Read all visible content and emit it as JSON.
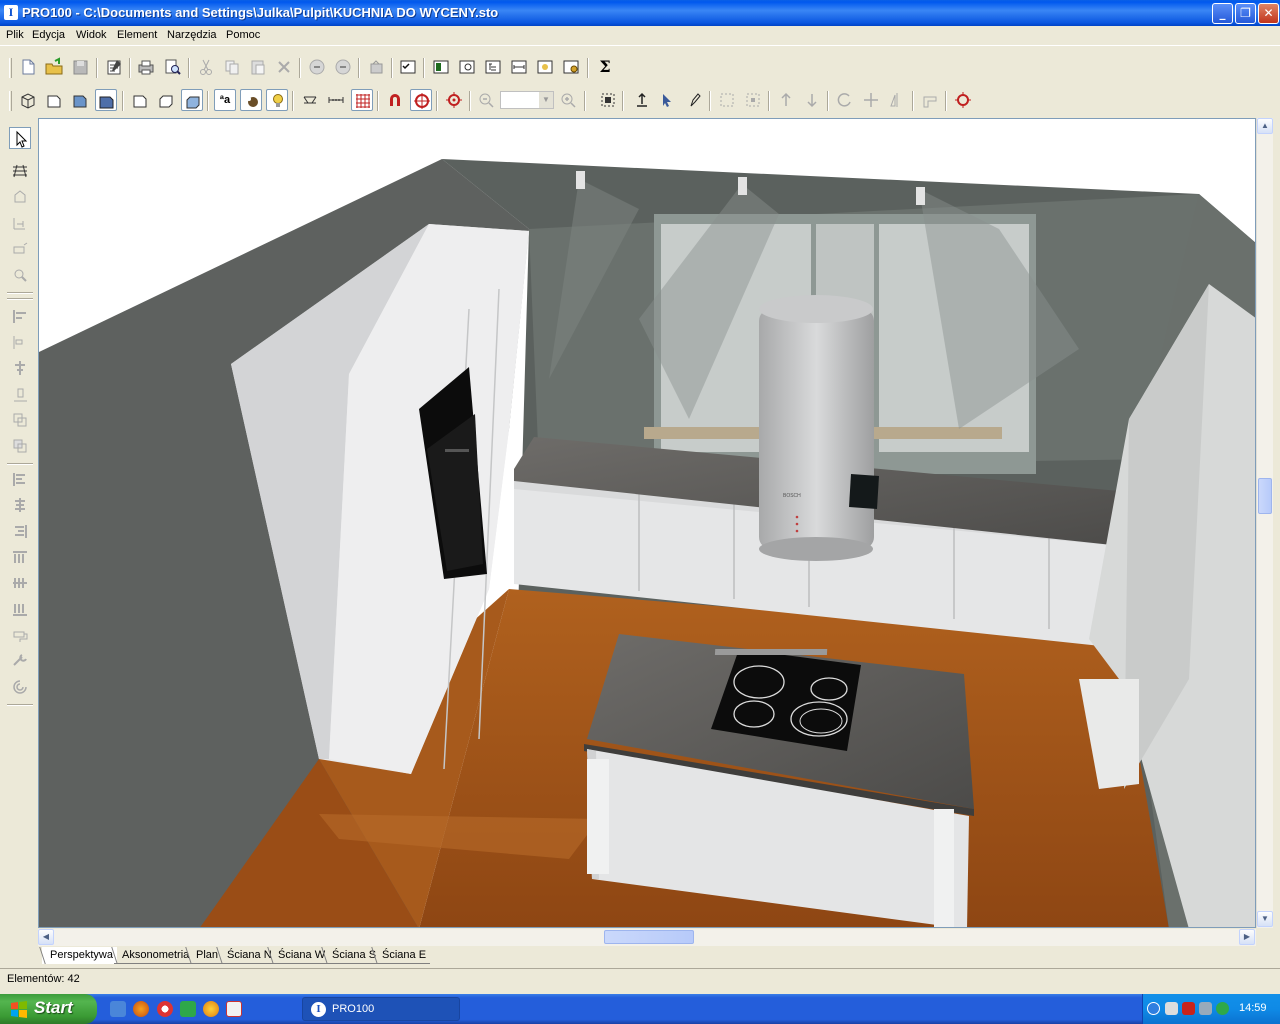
{
  "window": {
    "title": "PRO100 - C:\\Documents and Settings\\Julka\\Pulpit\\KUCHNIA DO WYCENY.sto",
    "app_icon_letter": "I",
    "controls": {
      "minimize": "_",
      "maximize": "❐",
      "close": "✕"
    }
  },
  "menu": [
    "Plik",
    "Edycja",
    "Widok",
    "Element",
    "Narzędzia",
    "Pomoc"
  ],
  "toolbar1": [
    "new-icon",
    "open-icon",
    "save-icon",
    "properties-icon",
    "print-icon",
    "print-preview-icon",
    "cut-icon",
    "copy-icon",
    "paste-icon",
    "delete-icon",
    "undo-icon",
    "redo-icon",
    "group-icon",
    "checklist-icon",
    "catalog-icon",
    "browse-icon",
    "tree-icon",
    "dimension-icon",
    "render-icon",
    "texture-icon",
    "sum-icon"
  ],
  "toolbar1_sum_glyph": "Σ",
  "toolbar2": [
    "view-box-1-icon",
    "view-box-2-icon",
    "view-box-3-icon",
    "view-box-4-icon",
    "wall-1-icon",
    "wall-2-icon",
    "wall-3-icon",
    "text-icon",
    "material-icon",
    "light-icon",
    "measure-icon",
    "ruler-icon",
    "grid-icon",
    "magnet-icon",
    "snap-icon",
    "target-icon",
    "zoom-out-icon",
    "zoom-combo",
    "zoom-in-icon",
    "select-all-icon",
    "align-icon",
    "move-icon",
    "edit-icon"
  ],
  "toolbar2_text_glyph": "ªa",
  "left_tools": [
    "pointer-icon",
    "wall-tool-icon",
    "shape-icon",
    "dimension-tool-icon",
    "label-tool-icon",
    "zoom-tool-icon",
    "align-left-icon",
    "align-center-icon",
    "align-right-icon",
    "distribute-icon",
    "copy-tool-icon",
    "copy-tool-2-icon",
    "stack-1-icon",
    "stack-2-icon",
    "stack-3-icon",
    "stack-4-icon",
    "stack-5-icon",
    "stack-6-icon",
    "paint-icon",
    "wrench-icon",
    "spiral-icon"
  ],
  "scene": {
    "hob_brand": "BOSCH",
    "colors": {
      "wall": "#5a5d5b",
      "floor": "#a8551a",
      "cabinet": "#e9e9ea",
      "countertop": "#5b5a58",
      "hob": "#0c0c0c"
    }
  },
  "tabs": [
    "Perspektywa",
    "Aksonometria",
    "Plan",
    "Ściana N",
    "Ściana W",
    "Ściana S",
    "Ściana E"
  ],
  "active_tab": "Perspektywa",
  "status": {
    "text": "Elementów: 42"
  },
  "taskbar": {
    "start": "Start",
    "task": "PRO100",
    "task_icon_letter": "I",
    "clock": "14:59"
  }
}
